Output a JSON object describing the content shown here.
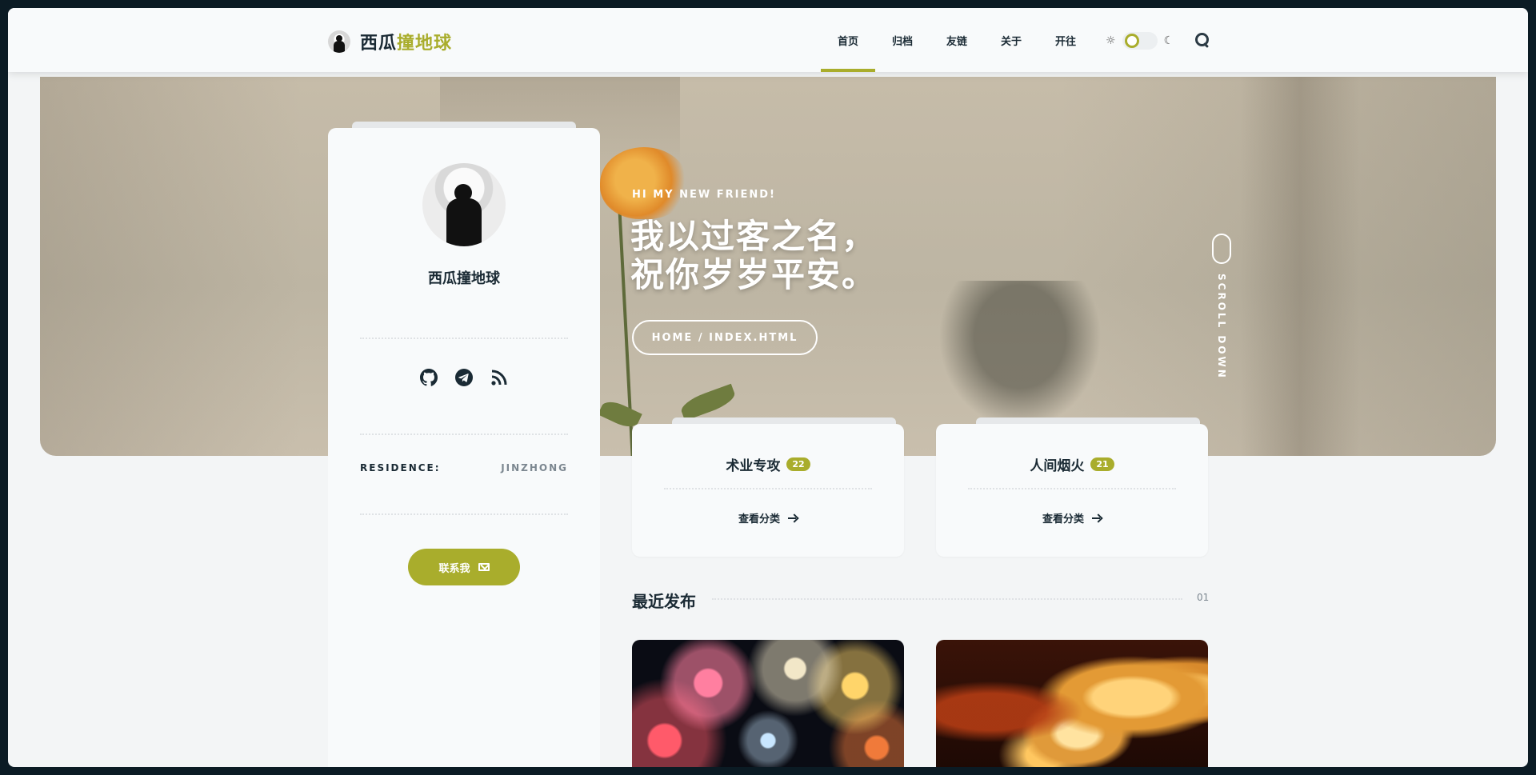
{
  "brand": {
    "name_part1": "西瓜",
    "name_part2": "撞地球"
  },
  "nav": {
    "items": [
      "首页",
      "归档",
      "友链",
      "关于",
      "开往"
    ],
    "active_index": 0
  },
  "theme_toggle": {
    "mode": "light"
  },
  "hero": {
    "tagline": "HI MY NEW FRIEND!",
    "title_line1": "我以过客之名，",
    "title_line2": "祝你岁岁平安。",
    "breadcrumb": "HOME /  INDEX.HTML",
    "scroll_label": "SCROLL DOWN"
  },
  "profile": {
    "name": "西瓜撞地球",
    "socials": [
      "github-icon",
      "telegram-icon",
      "rss-icon"
    ],
    "residence_label": "RESIDENCE:",
    "residence_value": "JINZHONG",
    "contact_label": "联系我"
  },
  "categories": [
    {
      "title": "术业专攻",
      "count": "22",
      "link": "查看分类"
    },
    {
      "title": "人间烟火",
      "count": "21",
      "link": "查看分类"
    }
  ],
  "recent": {
    "title": "最近发布",
    "page": "01"
  },
  "colors": {
    "accent": "#a9ad2c",
    "text": "#1a2a34",
    "background": "#f3f5f6"
  }
}
